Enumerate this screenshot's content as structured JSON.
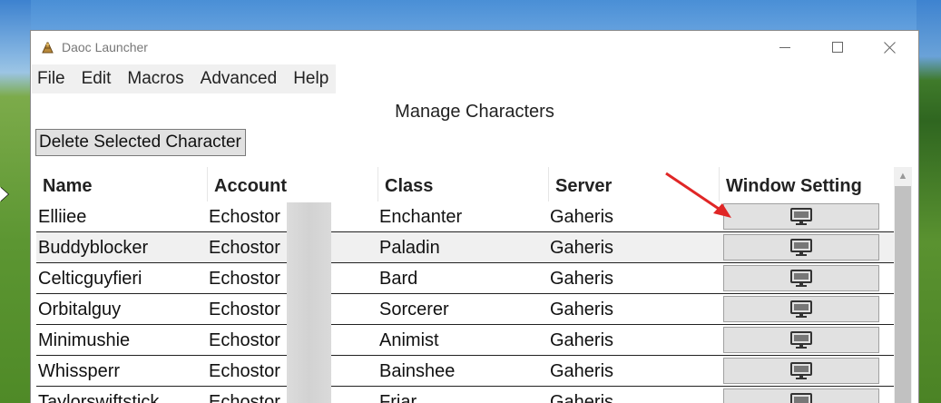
{
  "window": {
    "title": "Daoc Launcher",
    "controls": {
      "minimize": "minimize",
      "maximize": "maximize",
      "close": "close"
    }
  },
  "menu": [
    "File",
    "Edit",
    "Macros",
    "Advanced",
    "Help"
  ],
  "page": {
    "heading": "Manage Characters",
    "delete_button": "Delete Selected Character"
  },
  "table": {
    "columns": [
      "Name",
      "Account",
      "Class",
      "Server",
      "Window Setting"
    ],
    "rows": [
      {
        "name": "Elliiee",
        "account": "Echostor",
        "class": "Enchanter",
        "server": "Gaheris"
      },
      {
        "name": "Buddyblocker",
        "account": "Echostor",
        "class": "Paladin",
        "server": "Gaheris"
      },
      {
        "name": "Celticguyfieri",
        "account": "Echostor",
        "class": "Bard",
        "server": "Gaheris"
      },
      {
        "name": "Orbitalguy",
        "account": "Echostor",
        "class": "Sorcerer",
        "server": "Gaheris"
      },
      {
        "name": "Minimushie",
        "account": "Echostor",
        "class": "Animist",
        "server": "Gaheris"
      },
      {
        "name": "Whissperr",
        "account": "Echostor",
        "class": "Bainshee",
        "server": "Gaheris"
      },
      {
        "name": "Taylorswiftstick",
        "account": "Echostor",
        "class": "Friar",
        "server": "Gaheris"
      }
    ],
    "window_setting_icon": "monitor-icon"
  },
  "colors": {
    "annotation_arrow": "#e02626",
    "button_face": "#e1e1e1",
    "menubar": "#f0f0f0"
  }
}
